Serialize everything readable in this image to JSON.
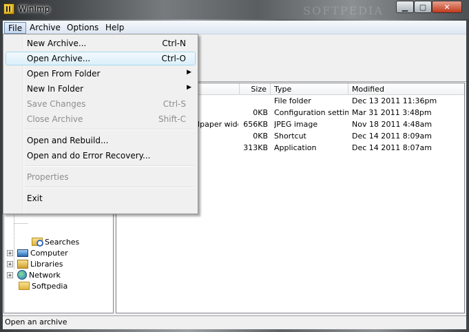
{
  "window": {
    "title": "WinImp",
    "watermark": "SOFTPEDIA",
    "min_glyph": "▁",
    "max_glyph": "▢",
    "close_glyph": "✕"
  },
  "menubar": [
    {
      "label": "File"
    },
    {
      "label": "Archive"
    },
    {
      "label": "Options"
    },
    {
      "label": "Help"
    }
  ],
  "file_menu": [
    {
      "label": "New Archive...",
      "shortcut": "Ctrl-N"
    },
    {
      "label": "Open Archive...",
      "shortcut": "Ctrl-O"
    },
    {
      "label": "Open From Folder",
      "submenu": "▶"
    },
    {
      "label": "New In Folder",
      "submenu": "▶"
    },
    {
      "label": "Save Changes",
      "shortcut": "Ctrl-S"
    },
    {
      "label": "Close Archive",
      "shortcut": "Shift-C"
    },
    {
      "label": "Open and Rebuild..."
    },
    {
      "label": "Open and do Error Recovery..."
    },
    {
      "label": "Properties"
    },
    {
      "label": "Exit"
    }
  ],
  "tree": [
    {
      "label": "Searches",
      "expander": ""
    },
    {
      "label": "Computer",
      "expander": "+"
    },
    {
      "label": "Libraries",
      "expander": "+"
    },
    {
      "label": "Network",
      "expander": "+"
    },
    {
      "label": "Softpedia",
      "expander": ""
    }
  ],
  "list": {
    "columns": [
      "Size",
      "Type",
      "Modified"
    ],
    "rows": [
      {
        "name": "",
        "size": "",
        "type": "File folder",
        "modified": "Dec 13 2011 11:36pm"
      },
      {
        "name": "",
        "size": "0KB",
        "type": "Configuration settings",
        "modified": "Mar 31 2011 3:48pm"
      },
      {
        "name": "llpaper wide",
        "size": "656KB",
        "type": "JPEG image",
        "modified": "Nov 18 2011 4:48am"
      },
      {
        "name": "",
        "size": "0KB",
        "type": "Shortcut",
        "modified": "Dec 14 2011 8:09am"
      },
      {
        "name": "",
        "size": "313KB",
        "type": "Application",
        "modified": "Dec 14 2011 8:07am"
      }
    ]
  },
  "status": {
    "text": "Open an archive"
  }
}
